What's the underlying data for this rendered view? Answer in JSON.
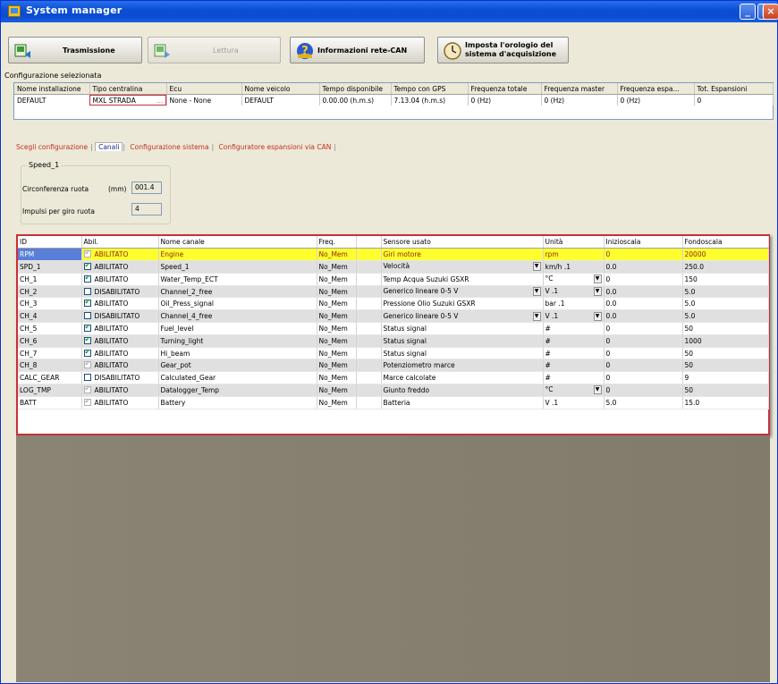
{
  "window": {
    "title": "System manager"
  },
  "toolbar": {
    "transmit_label": "Trasmissione",
    "read_label": "Lettura",
    "can_info_label": "Informazioni rete-CAN",
    "clock_label_line1": "Imposta l'orologio del",
    "clock_label_line2": "sistema d'acquisizione"
  },
  "config_section": {
    "label": "Configurazione selezionata",
    "headers": [
      "Nome installazione",
      "Tipo centralina",
      "Ecu",
      "Nome veicolo",
      "Tempo disponibile",
      "Tempo con GPS",
      "Frequenza totale",
      "Frequenza master",
      "Frequenza espa...",
      "Tot. Espansioni"
    ],
    "row": [
      "DEFAULT",
      "MXL STRADA",
      "None - None",
      "DEFAULT",
      "0.00.00 (h.m.s)",
      "7.13.04 (h.m.s)",
      "0 (Hz)",
      "0 (Hz)",
      "0 (Hz)",
      "0"
    ]
  },
  "tabs": [
    "Scegli configurazione",
    "Canali",
    "Configurazione sistema",
    "Configuratore espansioni via CAN"
  ],
  "speed_group": {
    "title": "Speed_1",
    "circ_label": "Circonferenza ruota",
    "circ_unit": "(mm)",
    "circ_value": "001.4",
    "pulses_label": "Impulsi per giro ruota",
    "pulses_value": "4"
  },
  "channels": {
    "headers": [
      "ID",
      "Abil.",
      "Nome canale",
      "Freq.",
      "Sensore usato",
      "Unità",
      "Inizioscala",
      "Fondoscala"
    ],
    "rows": [
      {
        "id": "RPM",
        "enabled": true,
        "state": "ABILITATO",
        "name": "Engine",
        "freq": "No_Mem",
        "sensor": "Giri motore",
        "unit": "rpm",
        "start": "0",
        "end": "20000"
      },
      {
        "id": "SPD_1",
        "enabled": true,
        "state": "ABILITATO",
        "name": "Speed_1",
        "freq": "No_Mem",
        "sensor": "Velocità",
        "unit": "km/h .1",
        "start": "0.0",
        "end": "250.0"
      },
      {
        "id": "CH_1",
        "enabled": true,
        "state": "ABILITATO",
        "name": "Water_Temp_ECT",
        "freq": "No_Mem",
        "sensor": "Temp Acqua Suzuki GSXR",
        "unit": "°C",
        "start": "0",
        "end": "150"
      },
      {
        "id": "CH_2",
        "enabled": false,
        "state": "DISABILITATO",
        "name": "Channel_2_free",
        "freq": "No_Mem",
        "sensor": "Generico lineare 0-5 V",
        "unit": "V .1",
        "start": "0.0",
        "end": "5.0"
      },
      {
        "id": "CH_3",
        "enabled": true,
        "state": "ABILITATO",
        "name": "Oil_Press_signal",
        "freq": "No_Mem",
        "sensor": "Pressione Olio Suzuki GSXR",
        "unit": "bar .1",
        "start": "0.0",
        "end": "5.0"
      },
      {
        "id": "CH_4",
        "enabled": false,
        "state": "DISABILITATO",
        "name": "Channel_4_free",
        "freq": "No_Mem",
        "sensor": "Generico lineare 0-5 V",
        "unit": "V .1",
        "start": "0.0",
        "end": "5.0"
      },
      {
        "id": "CH_5",
        "enabled": true,
        "state": "ABILITATO",
        "name": "Fuel_level",
        "freq": "No_Mem",
        "sensor": "Status signal",
        "unit": "#",
        "start": "0",
        "end": "50"
      },
      {
        "id": "CH_6",
        "enabled": true,
        "state": "ABILITATO",
        "name": "Turning_light",
        "freq": "No_Mem",
        "sensor": "Status signal",
        "unit": "#",
        "start": "0",
        "end": "1000"
      },
      {
        "id": "CH_7",
        "enabled": true,
        "state": "ABILITATO",
        "name": "Hi_beam",
        "freq": "No_Mem",
        "sensor": "Status signal",
        "unit": "#",
        "start": "0",
        "end": "50"
      },
      {
        "id": "CH_8",
        "enabled": true,
        "state": "ABILITATO",
        "name": "Gear_pot",
        "freq": "No_Mem",
        "sensor": "Potenziometro marce",
        "unit": "#",
        "start": "0",
        "end": "50"
      },
      {
        "id": "CALC_GEAR",
        "enabled": false,
        "state": "DISABILITATO",
        "name": "Calculated_Gear",
        "freq": "No_Mem",
        "sensor": "Marce calcolate",
        "unit": "#",
        "start": "0",
        "end": "9"
      },
      {
        "id": "LOG_TMP",
        "enabled": true,
        "state": "ABILITATO",
        "name": "Datalogger_Temp",
        "freq": "No_Mem",
        "sensor": "Giunto freddo",
        "unit": "°C",
        "start": "0",
        "end": "50"
      },
      {
        "id": "BATT",
        "enabled": true,
        "state": "ABILITATO",
        "name": "Battery",
        "freq": "No_Mem",
        "sensor": "Batteria",
        "unit": "V .1",
        "start": "5.0",
        "end": "15.0"
      }
    ]
  },
  "colors": {
    "titlebar": "#0a50d6",
    "selected_row": "#ffff30",
    "selected_id": "#5a7fd8",
    "grid_border": "#c8303a",
    "tab_text": "#c03020",
    "lower_panel": "#857f6f"
  }
}
